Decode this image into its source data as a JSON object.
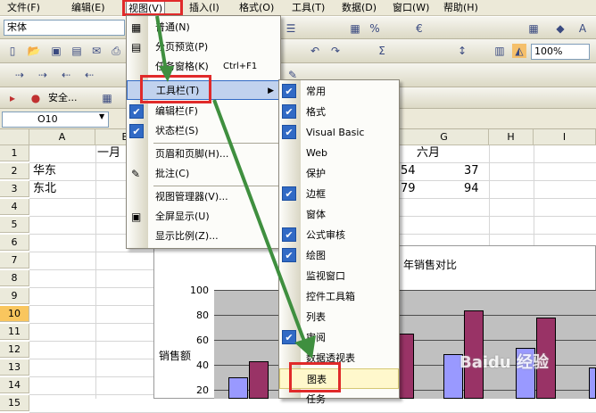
{
  "menubar": {
    "items": [
      "文件(F)",
      "编辑(E)",
      "视图(V)",
      "插入(I)",
      "格式(O)",
      "工具(T)",
      "数据(D)",
      "窗口(W)",
      "帮助(H)"
    ]
  },
  "toolbar": {
    "font_name": "宋体",
    "zoom": "100%",
    "security_label": "安全..."
  },
  "namebox": {
    "cell_ref": "O10"
  },
  "columns": [
    "A",
    "B",
    "G",
    "H",
    "I"
  ],
  "rows": [
    "1",
    "2",
    "3",
    "4",
    "5",
    "6",
    "7",
    "8",
    "9",
    "10",
    "11",
    "12",
    "13",
    "14",
    "15"
  ],
  "cells": {
    "a2": "华东",
    "a3": "东北",
    "b1": "一月",
    "g1": "六月",
    "f2": "54",
    "g2": "37",
    "f3": "79",
    "g3": "94"
  },
  "chart": {
    "title_fragment": "年销售对比",
    "ylabel": "销售额",
    "yticks": [
      "100",
      "80",
      "60",
      "40",
      "20"
    ]
  },
  "view_menu": {
    "items": [
      {
        "label": "普通(N)",
        "shortcut": ""
      },
      {
        "label": "分页预览(P)",
        "shortcut": ""
      },
      {
        "label": "任务窗格(K)",
        "shortcut": "Ctrl+F1"
      },
      {
        "label": "工具栏(T)",
        "shortcut": ""
      },
      {
        "label": "编辑栏(F)",
        "shortcut": ""
      },
      {
        "label": "状态栏(S)",
        "shortcut": ""
      },
      {
        "label": "页眉和页脚(H)...",
        "shortcut": ""
      },
      {
        "label": "批注(C)",
        "shortcut": ""
      },
      {
        "label": "视图管理器(V)...",
        "shortcut": ""
      },
      {
        "label": "全屏显示(U)",
        "shortcut": ""
      },
      {
        "label": "显示比例(Z)...",
        "shortcut": ""
      }
    ]
  },
  "toolbars_submenu": {
    "items": [
      "常用",
      "格式",
      "Visual Basic",
      "Web",
      "保护",
      "边框",
      "窗体",
      "公式审核",
      "绘图",
      "监视窗口",
      "控件工具箱",
      "列表",
      "审阅",
      "数据透视表",
      "图表",
      "任务"
    ]
  },
  "watermark": "Baidu 经验",
  "colors": {
    "accent": "#316ac5",
    "highlight_box": "#e02a2a",
    "arrow": "#3f8f3f"
  }
}
